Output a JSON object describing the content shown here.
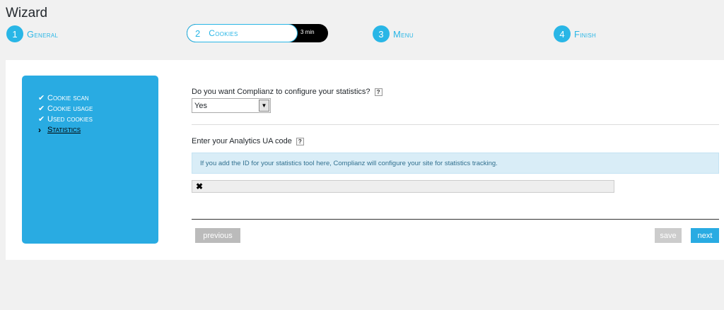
{
  "page": {
    "title": "Wizard"
  },
  "steps": [
    {
      "num": "1",
      "label": "General"
    },
    {
      "num": "2",
      "label": "Cookies",
      "time": "3 min"
    },
    {
      "num": "3",
      "label": "Menu"
    },
    {
      "num": "4",
      "label": "Finish"
    }
  ],
  "sidebar": {
    "items": [
      {
        "label": "Cookie scan",
        "done": true
      },
      {
        "label": "Cookie usage",
        "done": true
      },
      {
        "label": "Used cookies",
        "done": true
      },
      {
        "label": "Statistics",
        "current": true
      }
    ]
  },
  "form": {
    "question1": "Do you want Complianz to configure your statistics?",
    "question1_help": "?",
    "question1_value": "Yes",
    "question2": "Enter your Analytics UA code",
    "question2_help": "?",
    "info_text": "If you add the ID for your statistics tool here, Complianz will configure your site for statistics tracking.",
    "ua_value": "✖"
  },
  "buttons": {
    "previous": "previous",
    "save": "save",
    "next": "next"
  },
  "colors": {
    "accent": "#29abe2",
    "info_bg": "#d9edf7"
  }
}
